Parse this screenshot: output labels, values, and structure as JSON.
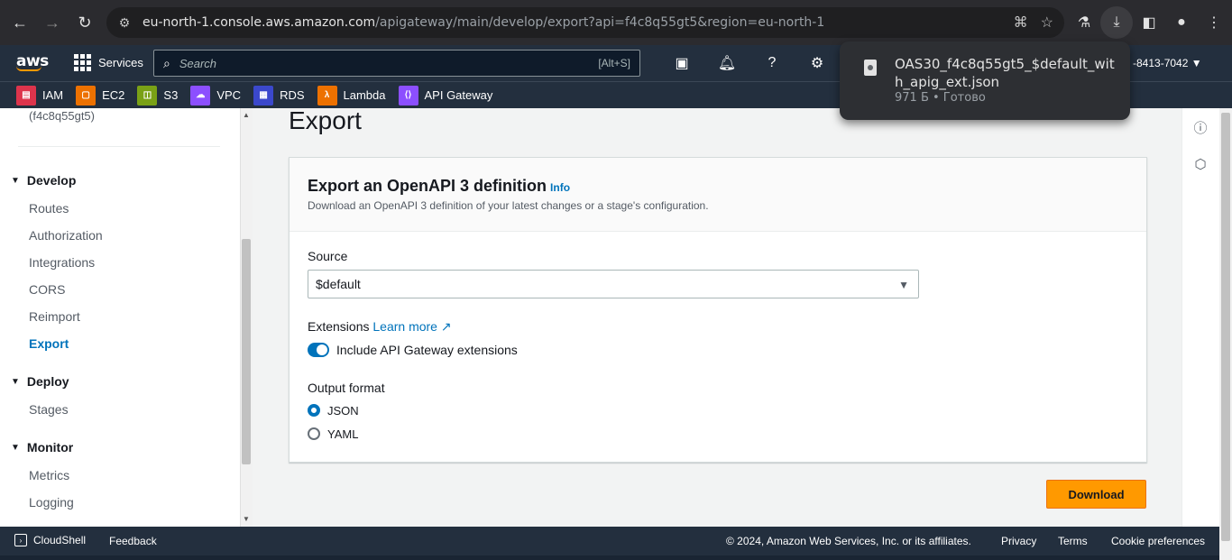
{
  "browser": {
    "url_host": "eu-north-1.console.aws.amazon.com",
    "url_path": "/apigateway/main/develop/export?api=f4c8q55gt5&region=eu-north-1"
  },
  "download": {
    "filename": "OAS30_f4c8q55gt5_$default_with_apig_ext.json",
    "meta": "971 Б • Готово"
  },
  "awsnav": {
    "logo": "aws",
    "services_label": "Services",
    "search_placeholder": "Search",
    "search_shortcut": "[Alt+S]",
    "account_suffix": "-8413-7042 ▼"
  },
  "favorites": [
    {
      "label": "IAM",
      "icon": "iam-icon",
      "color": "#dd344c"
    },
    {
      "label": "EC2",
      "icon": "ec2-icon",
      "color": "#ed7100"
    },
    {
      "label": "S3",
      "icon": "s3-icon",
      "color": "#7aa116"
    },
    {
      "label": "VPC",
      "icon": "vpc-icon",
      "color": "#8c4fff"
    },
    {
      "label": "RDS",
      "icon": "rds-icon",
      "color": "#3b48cc"
    },
    {
      "label": "Lambda",
      "icon": "lambda-icon",
      "color": "#ed7100"
    },
    {
      "label": "API Gateway",
      "icon": "api-gateway-icon",
      "color": "#8c4fff"
    }
  ],
  "sidebar": {
    "api_id": "(f4c8q55gt5)",
    "develop": {
      "title": "Develop",
      "items": [
        "Routes",
        "Authorization",
        "Integrations",
        "CORS",
        "Reimport",
        "Export"
      ]
    },
    "deploy": {
      "title": "Deploy",
      "items": [
        "Stages"
      ]
    },
    "monitor": {
      "title": "Monitor",
      "items": [
        "Metrics",
        "Logging"
      ]
    }
  },
  "main": {
    "title": "Export",
    "panel_title": "Export an OpenAPI 3 definition",
    "info": "Info",
    "panel_desc": "Download an OpenAPI 3 definition of your latest changes or a stage's configuration.",
    "source_label": "Source",
    "source_value": "$default",
    "extensions_label": "Extensions",
    "learn_more": "Learn more",
    "toggle_label": "Include API Gateway extensions",
    "toggle_on": true,
    "output_label": "Output format",
    "formats": [
      "JSON",
      "YAML"
    ],
    "selected_format": "JSON",
    "download_label": "Download"
  },
  "footer": {
    "cloudshell": "CloudShell",
    "feedback": "Feedback",
    "copyright": "© 2024, Amazon Web Services, Inc. or its affiliates.",
    "privacy": "Privacy",
    "terms": "Terms",
    "cookies": "Cookie preferences"
  }
}
